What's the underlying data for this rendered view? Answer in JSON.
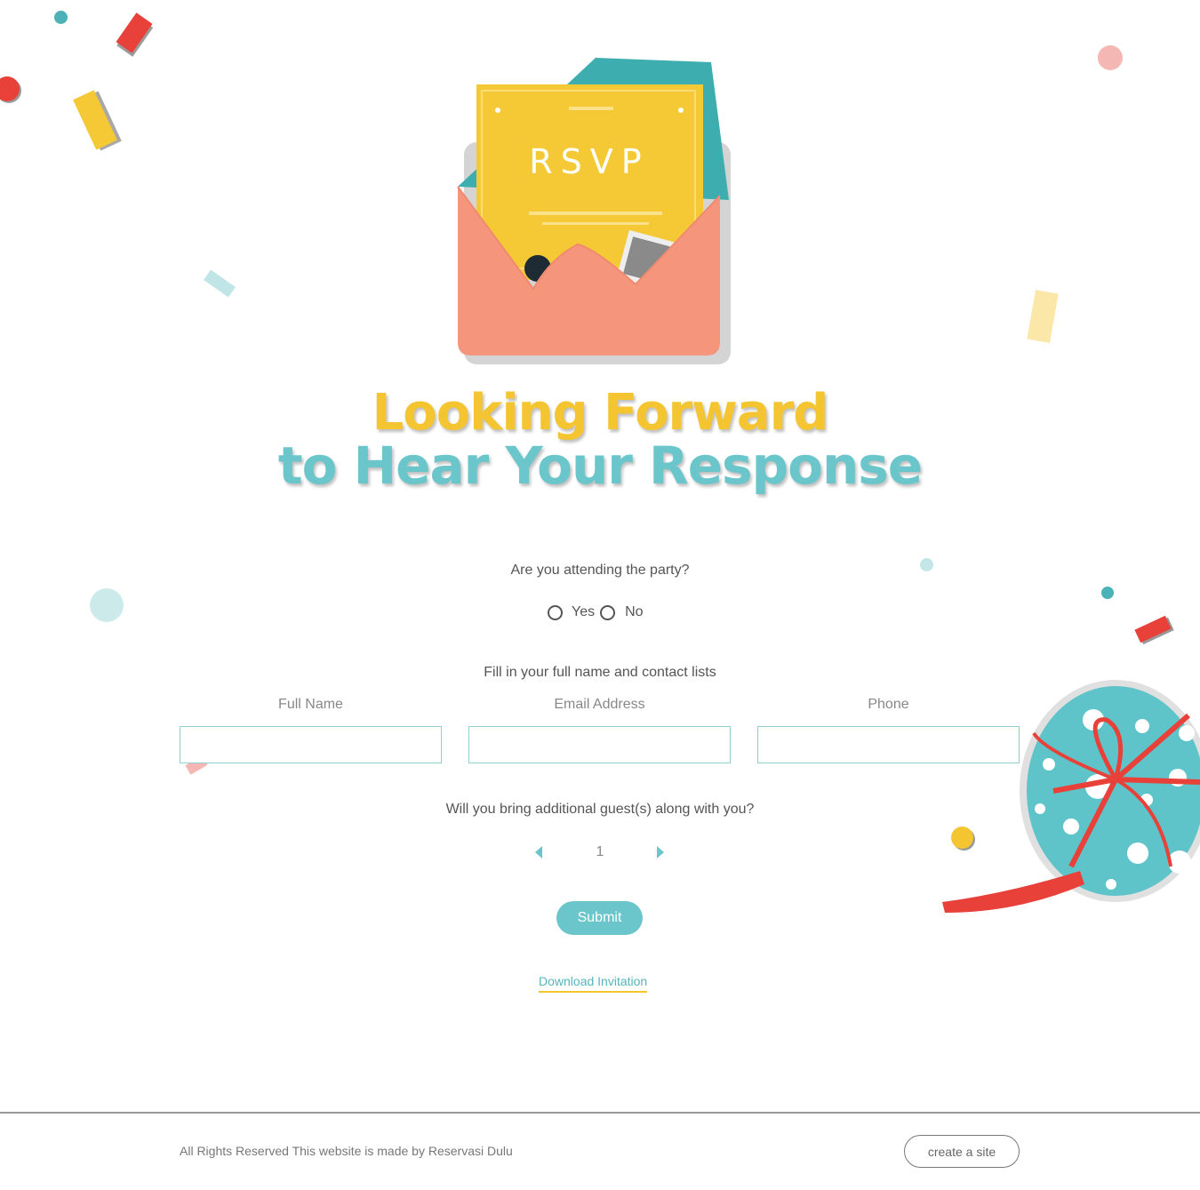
{
  "illustration": {
    "card_text": "RSVP",
    "colors": {
      "card": "#f4c935",
      "envelope": "#f5967c",
      "envelope_lining": "#3eadb0",
      "gift": "#5ec4c9",
      "ribbon": "#e8413a"
    }
  },
  "headline": {
    "line1": "Looking Forward",
    "line2": "to Hear Your Response",
    "colors": {
      "line1": "#f4c530",
      "line2": "#6ac6cb"
    }
  },
  "attendance": {
    "question": "Are you attending the party?",
    "options": [
      "Yes",
      "No"
    ]
  },
  "contact": {
    "prompt": "Fill in your full name and contact lists",
    "fields": [
      {
        "label": "Full Name",
        "value": ""
      },
      {
        "label": "Email Address",
        "value": ""
      },
      {
        "label": "Phone",
        "value": ""
      }
    ]
  },
  "guests": {
    "question": "Will you bring additional guest(s) along with you?",
    "count": "1"
  },
  "submit_label": "Submit",
  "download_label": "Download Invitation",
  "footer": {
    "text": "All Rights Reserved This website is made by Reservasi Dulu",
    "create_site_label": "create a site"
  }
}
